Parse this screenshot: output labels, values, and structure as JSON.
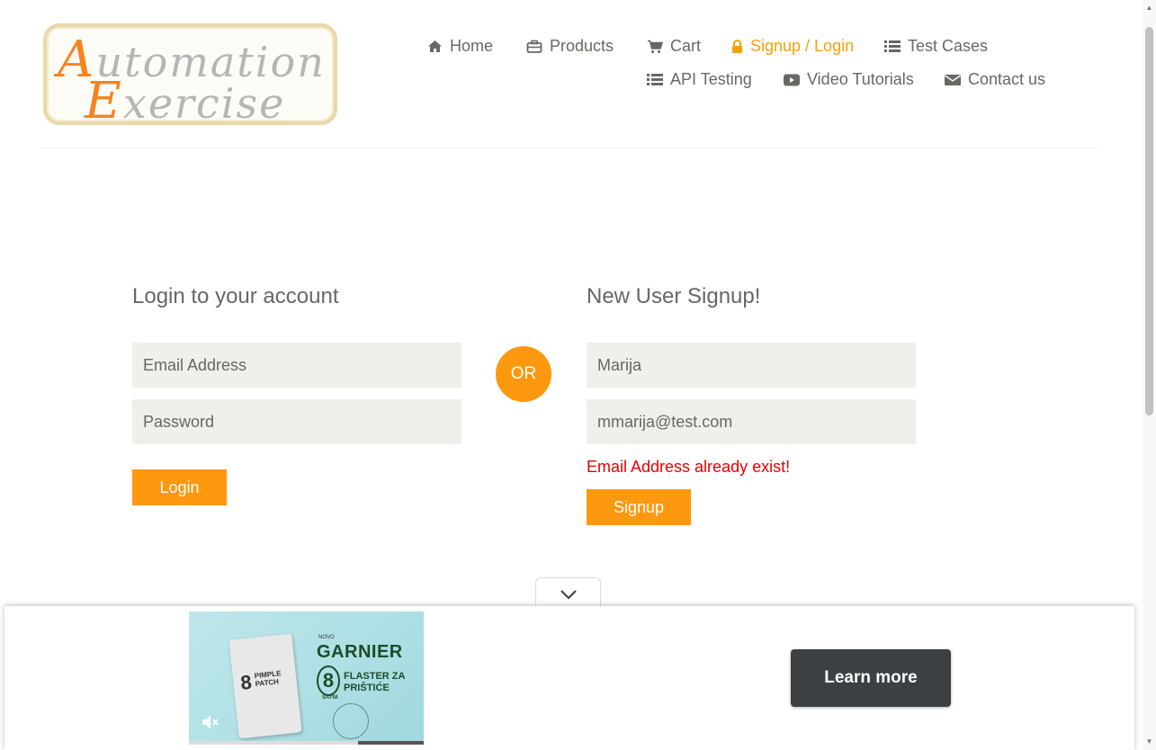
{
  "logo": {
    "line1_cap": "A",
    "line1_rest": "utomation",
    "line2_cap": "E",
    "line2_rest": "xercise"
  },
  "nav": {
    "home": "Home",
    "products": "Products",
    "cart": "Cart",
    "signup_login": "Signup / Login",
    "test_cases": "Test Cases",
    "api_testing": "API Testing",
    "video_tutorials": "Video Tutorials",
    "contact_us": "Contact us",
    "active": "signup_login"
  },
  "login": {
    "title": "Login to your account",
    "email_placeholder": "Email Address",
    "password_placeholder": "Password",
    "button": "Login"
  },
  "or_label": "OR",
  "signup": {
    "title": "New User Signup!",
    "name_value": "Marija",
    "email_value": "mmarija@test.com",
    "error": "Email Address already exist!",
    "button": "Signup"
  },
  "ad": {
    "novo": "NOVO",
    "brand": "GARNIER",
    "big_number": "8",
    "sub": "SATNI",
    "headline_line1": "FLASTER ZA",
    "headline_line2": "PRIŠTIĆE",
    "pack_number": "8",
    "pack_text_line1": "PIMPLE",
    "pack_text_line2": "PATCH",
    "learn_more": "Learn more",
    "progress": 0.72
  },
  "colors": {
    "accent": "#fe980f",
    "active_nav": "#f6a10b",
    "text": "#696763",
    "input_bg": "#f0efea",
    "error": "#e40000"
  }
}
